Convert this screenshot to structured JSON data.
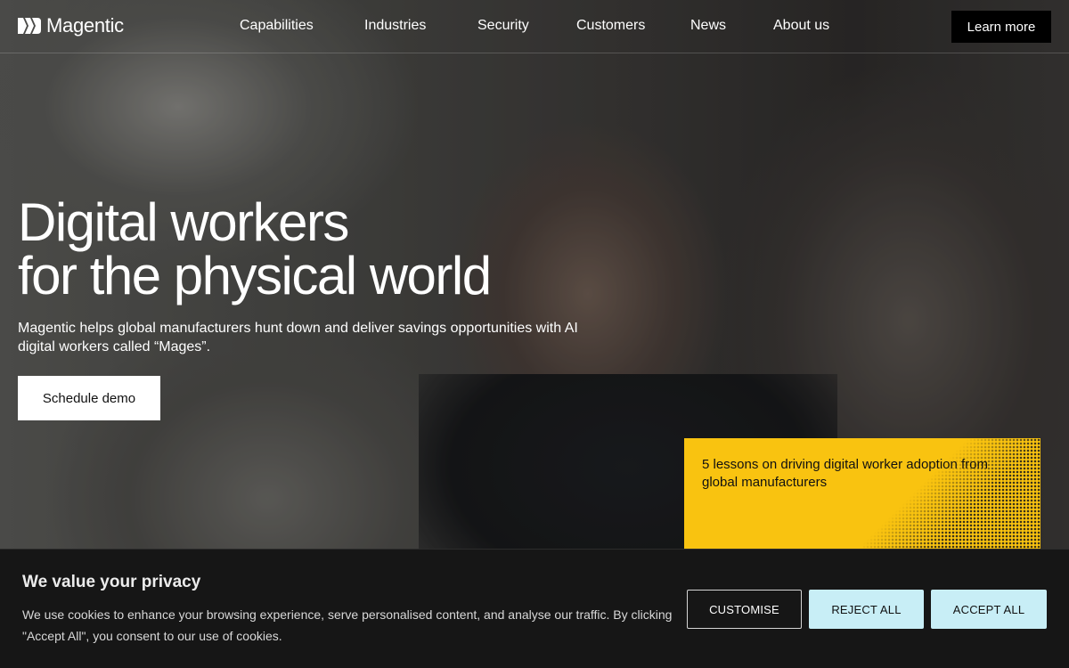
{
  "header": {
    "logo_text": "Magentic",
    "nav": [
      {
        "label": "Capabilities"
      },
      {
        "label": "Industries"
      },
      {
        "label": "Security"
      },
      {
        "label": "Customers"
      },
      {
        "label": "News"
      },
      {
        "label": "About us"
      }
    ],
    "cta_label": "Learn more"
  },
  "hero": {
    "title_line1": "Digital workers",
    "title_line2": "for the physical world",
    "subtitle": "Magentic helps global manufacturers hunt down and deliver savings opportunities with AI digital workers called “Mages”.",
    "button_label": "Schedule demo"
  },
  "promo": {
    "text": "5 lessons on driving digital worker adoption from global manufacturers",
    "background_color": "#f9c310"
  },
  "cookie_banner": {
    "title": "We value your privacy",
    "text": "We use cookies to enhance your browsing experience, serve personalised content, and analyse our traffic. By clicking \"Accept All\", you consent to our use of cookies.",
    "customise_label": "CUSTOMISE",
    "reject_label": "REJECT ALL",
    "accept_label": "ACCEPT ALL",
    "accent_color": "#c8eef6"
  },
  "icons": {
    "logo": "magentic-logo-icon"
  }
}
